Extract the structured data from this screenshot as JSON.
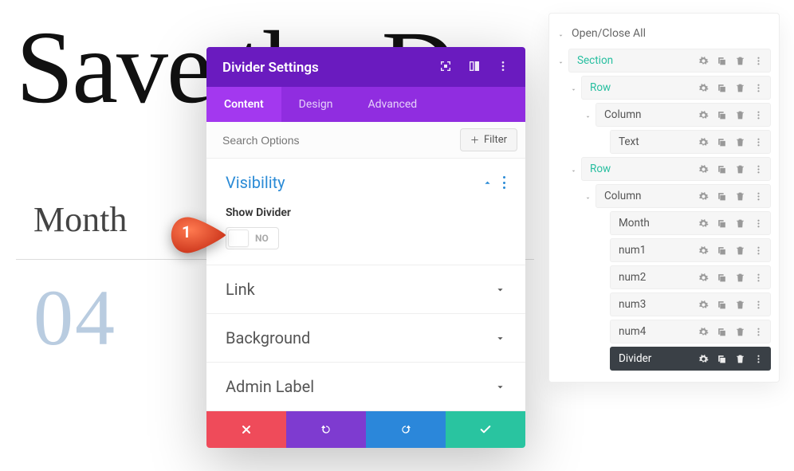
{
  "page": {
    "big_title": "Save the D",
    "month_label": "Month",
    "date_number": "04"
  },
  "modal": {
    "title": "Divider Settings",
    "tabs": {
      "content": "Content",
      "design": "Design",
      "advanced": "Advanced"
    },
    "search_placeholder": "Search Options",
    "filter_label": "Filter",
    "sections": {
      "visibility": {
        "title": "Visibility",
        "show_divider_label": "Show Divider",
        "toggle_text": "NO"
      },
      "link": {
        "title": "Link"
      },
      "background": {
        "title": "Background"
      },
      "admin_label": {
        "title": "Admin Label"
      }
    }
  },
  "callout": {
    "number": "1"
  },
  "layers": {
    "open_close": "Open/Close All",
    "items": [
      {
        "label": "Section",
        "style": "teal",
        "indent": 0,
        "caret": true
      },
      {
        "label": "Row",
        "style": "teal",
        "indent": 1,
        "caret": true
      },
      {
        "label": "Column",
        "style": "dark",
        "indent": 2,
        "caret": true
      },
      {
        "label": "Text",
        "style": "dark",
        "indent": 3,
        "caret": false
      },
      {
        "label": "Row",
        "style": "teal",
        "indent": 1,
        "caret": true
      },
      {
        "label": "Column",
        "style": "dark",
        "indent": 2,
        "caret": true
      },
      {
        "label": "Month",
        "style": "dark",
        "indent": 3,
        "caret": false
      },
      {
        "label": "num1",
        "style": "dark",
        "indent": 3,
        "caret": false
      },
      {
        "label": "num2",
        "style": "dark",
        "indent": 3,
        "caret": false
      },
      {
        "label": "num3",
        "style": "dark",
        "indent": 3,
        "caret": false
      },
      {
        "label": "num4",
        "style": "dark",
        "indent": 3,
        "caret": false
      },
      {
        "label": "Divider",
        "style": "selected",
        "indent": 3,
        "caret": false
      }
    ]
  }
}
